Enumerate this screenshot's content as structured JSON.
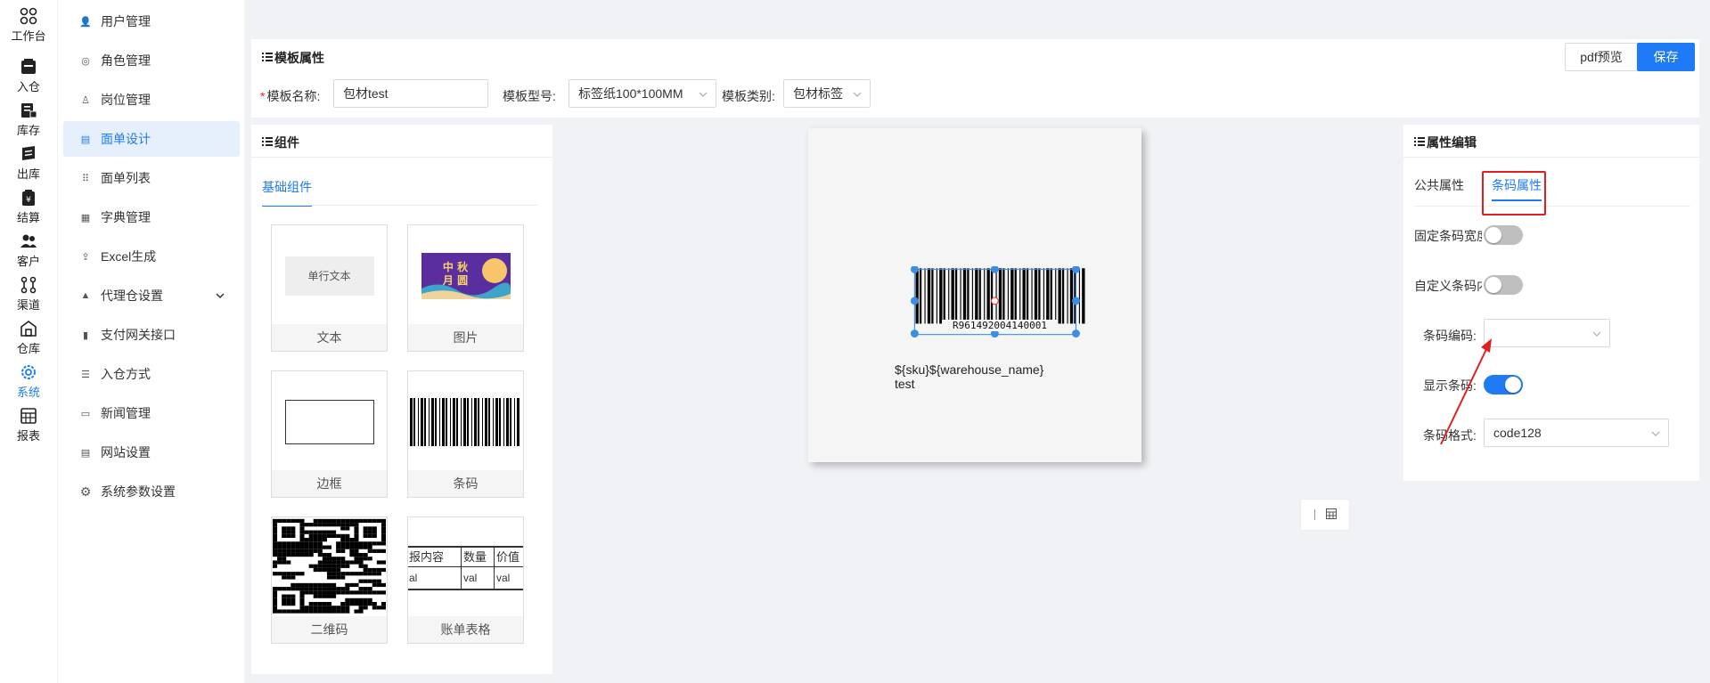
{
  "rail": [
    {
      "label": "工作台",
      "icon": "workbench-icon"
    },
    {
      "label": "入仓",
      "icon": "inbound-icon"
    },
    {
      "label": "库存",
      "icon": "inventory-icon"
    },
    {
      "label": "出库",
      "icon": "outbound-icon"
    },
    {
      "label": "结算",
      "icon": "settlement-icon"
    },
    {
      "label": "客户",
      "icon": "customers-icon"
    },
    {
      "label": "渠道",
      "icon": "channel-icon"
    },
    {
      "label": "仓库",
      "icon": "warehouse-icon"
    },
    {
      "label": "系统",
      "icon": "system-gear-icon"
    },
    {
      "label": "报表",
      "icon": "report-icon"
    }
  ],
  "menu": [
    {
      "label": "用户管理",
      "icon": "user-icon"
    },
    {
      "label": "角色管理",
      "icon": "role-icon"
    },
    {
      "label": "岗位管理",
      "icon": "post-icon"
    },
    {
      "label": "面单设计",
      "icon": "form-design-icon"
    },
    {
      "label": "面单列表",
      "icon": "form-list-icon"
    },
    {
      "label": "字典管理",
      "icon": "dictionary-icon"
    },
    {
      "label": "Excel生成",
      "icon": "excel-icon"
    },
    {
      "label": "代理仓设置",
      "icon": "agent-warehouse-icon"
    },
    {
      "label": "支付网关接口",
      "icon": "payment-icon"
    },
    {
      "label": "入仓方式",
      "icon": "inbound-method-icon"
    },
    {
      "label": "新闻管理",
      "icon": "news-icon"
    },
    {
      "label": "网站设置",
      "icon": "website-icon"
    },
    {
      "label": "系统参数设置",
      "icon": "gear-icon"
    }
  ],
  "header": {
    "title": "模板属性",
    "pdf_preview": "pdf预览",
    "save": "保存"
  },
  "form": {
    "name_label": "模板名称:",
    "name_value": "包材test",
    "model_label": "模板型号:",
    "model_value": "标签纸100*100MM",
    "category_label": "模板类别:",
    "category_value": "包材标签"
  },
  "components": {
    "title": "组件",
    "tab": "基础组件",
    "items": [
      {
        "label": "文本",
        "preview_text": "单行文本"
      },
      {
        "label": "图片",
        "preview_text": "中秋月圆"
      },
      {
        "label": "边框"
      },
      {
        "label": "条码"
      },
      {
        "label": "二维码"
      },
      {
        "label": "账单表格",
        "table_headers": [
          "报内容",
          "数量",
          "价值"
        ],
        "table_row": [
          "al",
          "val",
          "val"
        ]
      }
    ]
  },
  "canvas": {
    "barcode_number": "R961492004140001",
    "text_line1": "${sku}${warehouse_name}",
    "text_line2": "test"
  },
  "props": {
    "title": "属性编辑",
    "tab_common": "公共属性",
    "tab_barcode": "条码属性",
    "fixed_width_label": "固定条码宽度",
    "fixed_width_on": false,
    "custom_content_label": "自定义条码内容",
    "custom_content_on": false,
    "encoding_label": "条码编码:",
    "encoding_value": "",
    "show_barcode_label": "显示条码:",
    "show_barcode_on": true,
    "format_label": "条码格式:",
    "format_value": "code128"
  },
  "colors": {
    "accent": "#1f7af5",
    "highlight_box": "#e02020",
    "arrow": "#e02020"
  }
}
